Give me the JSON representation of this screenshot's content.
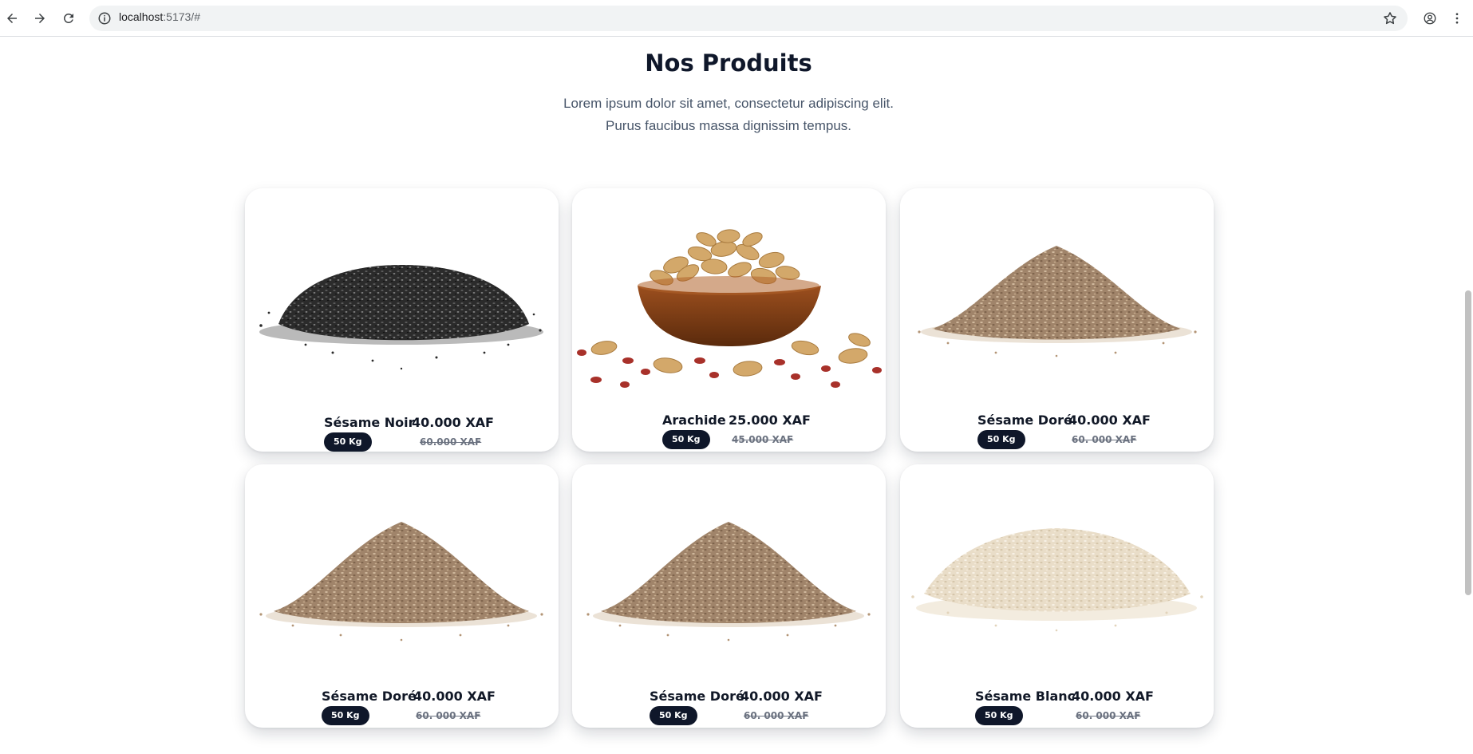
{
  "browser": {
    "url_host": "localhost",
    "url_path": ":5173/#"
  },
  "section": {
    "title": "Nos Produits",
    "description": "Lorem ipsum dolor sit amet, consectetur adipiscing elit. Purus faucibus massa dignissim tempus."
  },
  "colors": {
    "badge_bg": "#0f172a",
    "title": "#0f172a",
    "old_price": "#6b7280"
  },
  "products": [
    {
      "name": "Sésame Noir",
      "price": "40.000 XAF",
      "weight": "50 Kg",
      "old_price": "60.000 XAF",
      "image": "black-sesame-pile-image"
    },
    {
      "name": "Arachide",
      "price": "25.000 XAF",
      "weight": "50 Kg",
      "old_price": "45.000 XAF",
      "image": "peanuts-bowl-image"
    },
    {
      "name": "Sésame Doré",
      "price": "40.000 XAF",
      "weight": "50 Kg",
      "old_price": "60. 000 XAF",
      "image": "golden-sesame-pile-image"
    },
    {
      "name": "Sésame Doré",
      "price": "40.000 XAF",
      "weight": "50 Kg",
      "old_price": "60. 000 XAF",
      "image": "golden-sesame-pile-image"
    },
    {
      "name": "Sésame Doré",
      "price": "40.000 XAF",
      "weight": "50 Kg",
      "old_price": "60. 000 XAF",
      "image": "golden-sesame-pile-image"
    },
    {
      "name": "Sésame Blanc",
      "price": "40.000 XAF",
      "weight": "50 Kg",
      "old_price": "60. 000 XAF",
      "image": "white-sesame-pile-image"
    }
  ]
}
